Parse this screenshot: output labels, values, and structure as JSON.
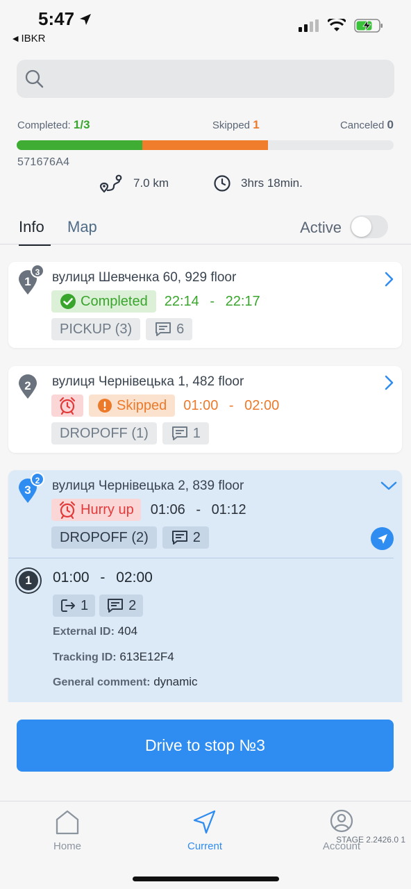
{
  "status_bar": {
    "time": "5:47",
    "back_app": "IBKR"
  },
  "search": {
    "placeholder": ""
  },
  "progress": {
    "completed_label": "Completed:",
    "completed_value": "1/3",
    "skipped_label": "Skipped",
    "skipped_value": "1",
    "canceled_label": "Canceled",
    "canceled_value": "0",
    "completed_fraction": 0.333,
    "skipped_fraction": 0.333
  },
  "route": {
    "id": "571676A4",
    "distance": "7.0 km",
    "duration": "3hrs 18min."
  },
  "tabs": {
    "info": "Info",
    "map": "Map",
    "active_label": "Active",
    "active_on": false
  },
  "stops": [
    {
      "number": "1",
      "badge": "3",
      "address": "вулиця Шевченка 60, 929 floor",
      "status": "Completed",
      "time_from": "22:14",
      "time_to": "22:17",
      "type": "PICKUP (3)",
      "comments": "6"
    },
    {
      "number": "2",
      "address": "вулиця Чернівецька 1, 482 floor",
      "status": "Skipped",
      "time_from": "01:00",
      "time_to": "02:00",
      "type": "DROPOFF (1)",
      "comments": "1"
    },
    {
      "number": "3",
      "badge": "2",
      "address": "вулиця Чернівецька 2, 839 floor",
      "status": "Hurry up",
      "time_from": "01:06",
      "time_to": "01:12",
      "type": "DROPOFF (2)",
      "comments": "2",
      "order": {
        "number": "1",
        "time_from": "01:00",
        "time_to": "02:00",
        "items": "1",
        "comments": "2",
        "external_id_label": "External ID:",
        "external_id": "404",
        "tracking_id_label": "Tracking ID:",
        "tracking_id": "613E12F4",
        "comment_label": "General comment:",
        "comment": "dynamic"
      }
    }
  ],
  "time_separator": "-",
  "cta": {
    "label": "Drive to stop №3"
  },
  "tabbar": {
    "home": "Home",
    "current": "Current",
    "account": "Account",
    "stage": "STAGE 2.2426.0 1"
  },
  "colors": {
    "primary": "#2f8cf0",
    "completed": "#3fac33",
    "skipped": "#ef7d2c",
    "urgent": "#e23a3a"
  }
}
